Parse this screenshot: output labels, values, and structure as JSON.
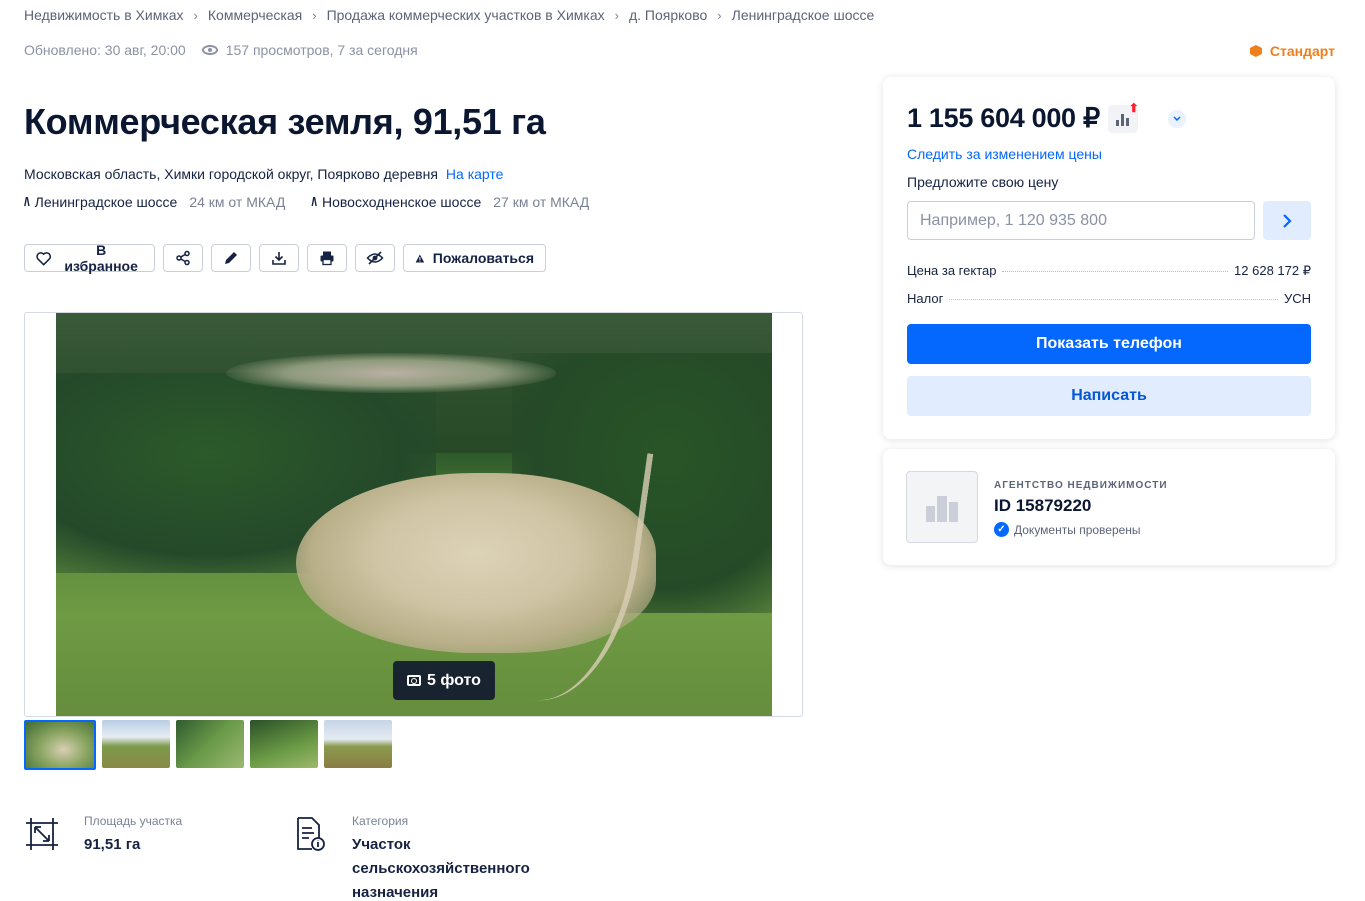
{
  "breadcrumbs": [
    "Недвижимость в Химках",
    "Коммерческая",
    "Продажа коммерческих участков в Химках",
    "д. Поярково",
    "Ленинградское шоссе"
  ],
  "meta": {
    "updated": "Обновлено: 30 авг, 20:00",
    "views": "157 просмотров, 7 за сегодня",
    "tariff": "Стандарт"
  },
  "title": "Коммерческая земля, 91,51 га",
  "address": {
    "text": "Московская область, Химки городской округ, Поярково деревня",
    "map_link": "На карте"
  },
  "roads": [
    {
      "name": "Ленинградское шоссе",
      "distance": "24 км от МКАД"
    },
    {
      "name": "Новосходненское шоссе",
      "distance": "27 км от МКАД"
    }
  ],
  "actions": {
    "favorite": "В избранное",
    "complain": "Пожаловаться"
  },
  "gallery": {
    "photo_count": "5 фото"
  },
  "features": [
    {
      "label": "Площадь участка",
      "value": "91,51 га"
    },
    {
      "label": "Категория",
      "value_lines": [
        "Участок",
        "сельскохозяйственного",
        "назначения"
      ]
    }
  ],
  "price_card": {
    "price": "1 155 604 000 ₽",
    "follow": "Следить за изменением цены",
    "offer_label": "Предложите свою цену",
    "offer_placeholder": "Например, 1 120 935 800",
    "rows": [
      {
        "key": "Цена за гектар",
        "value": "12 628 172 ₽"
      },
      {
        "key": "Налог",
        "value": "УСН"
      }
    ],
    "show_phone": "Показать телефон",
    "write": "Написать"
  },
  "agency": {
    "type": "АГЕНТСТВО НЕДВИЖИМОСТИ",
    "id": "ID 15879220",
    "verified": "Документы проверены"
  },
  "colors": {
    "accent": "#0468ff",
    "tariff": "#ef7f1a",
    "price_up": "#ff1f34"
  }
}
